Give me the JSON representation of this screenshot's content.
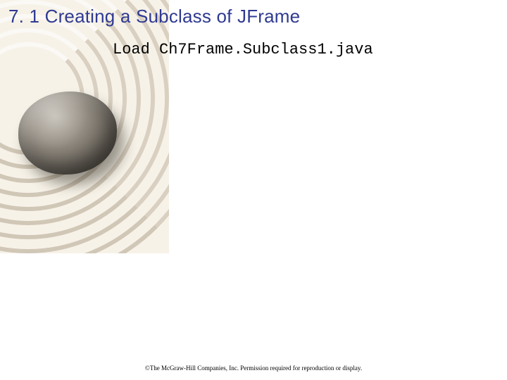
{
  "heading": "7. 1 Creating a Subclass of JFrame",
  "code_line": "Load Ch7Frame.Subclass1.java",
  "copyright": "©The McGraw-Hill Companies, Inc. Permission required for reproduction or display."
}
